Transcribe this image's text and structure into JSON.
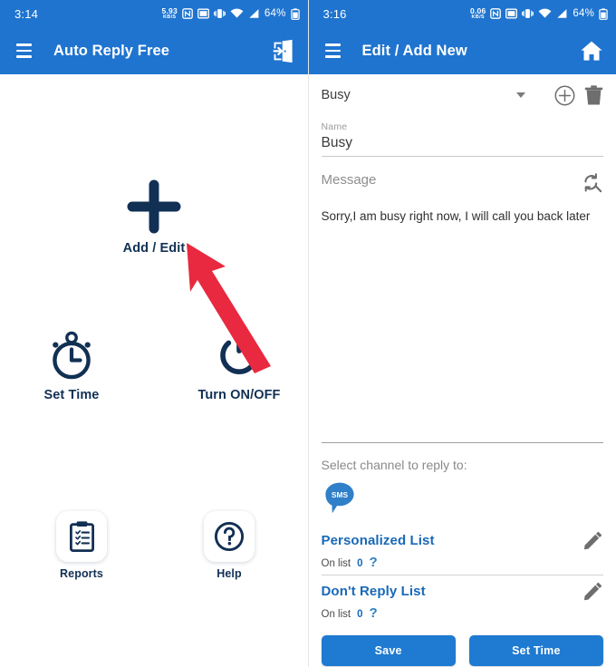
{
  "theme": {
    "header_blue": "#1f74cf",
    "icon_navy": "#123054",
    "link_blue": "#1869b8",
    "button_blue": "#1f7ad1",
    "arrow_red": "#e8293f",
    "gray_icon": "#6e6e6e"
  },
  "left": {
    "status": {
      "time": "3:14",
      "data_rate_value": "5.93",
      "data_rate_unit": "KB/S",
      "battery_percent": "64%",
      "icons": [
        "nfc-icon",
        "screen-record-icon",
        "vibrate-icon",
        "wifi-icon",
        "signal-icon",
        "battery-icon"
      ]
    },
    "appbar": {
      "menu_icon": "hamburger-icon",
      "title": "Auto Reply Free",
      "action_icon": "exit-door-icon"
    },
    "tiles": [
      {
        "id": "add-edit",
        "label": "Add / Edit",
        "icon": "plus-icon"
      },
      {
        "id": "set-time",
        "label": "Set Time",
        "icon": "stopwatch-icon"
      },
      {
        "id": "turn-on-off",
        "label": "Turn ON/OFF",
        "icon": "power-icon"
      },
      {
        "id": "reports",
        "label": "Reports",
        "icon": "clipboard-icon"
      },
      {
        "id": "help",
        "label": "Help",
        "icon": "question-mark-icon"
      }
    ],
    "annotation": {
      "type": "arrow",
      "points_at": "Add / Edit"
    }
  },
  "right": {
    "status": {
      "time": "3:16",
      "data_rate_value": "0.06",
      "data_rate_unit": "KB/S",
      "battery_percent": "64%",
      "icons": [
        "nfc-icon",
        "screen-record-icon",
        "vibrate-icon",
        "wifi-icon",
        "signal-icon",
        "battery-icon"
      ]
    },
    "appbar": {
      "menu_icon": "hamburger-icon",
      "title": "Edit / Add New",
      "action_icon": "home-icon"
    },
    "profile_select": {
      "value": "Busy",
      "add_icon": "add-circle-icon",
      "delete_icon": "trash-icon"
    },
    "name_field": {
      "label": "Name",
      "value": "Busy"
    },
    "message_field": {
      "label": "Message",
      "value": "Sorry,I am busy right now, I will call you back later",
      "action_icon": "sync-search-icon"
    },
    "channel_section": {
      "heading": "Select channel to reply to:",
      "channel_icon_label": "SMS"
    },
    "lists": [
      {
        "title": "Personalized List",
        "on_list_label": "On list",
        "count": "0",
        "help": "?",
        "edit_icon": "pencil-icon"
      },
      {
        "title": "Don't Reply List",
        "on_list_label": "On list",
        "count": "0",
        "help": "?",
        "edit_icon": "pencil-icon"
      }
    ],
    "buttons": {
      "save": "Save",
      "set_time": "Set Time"
    }
  }
}
